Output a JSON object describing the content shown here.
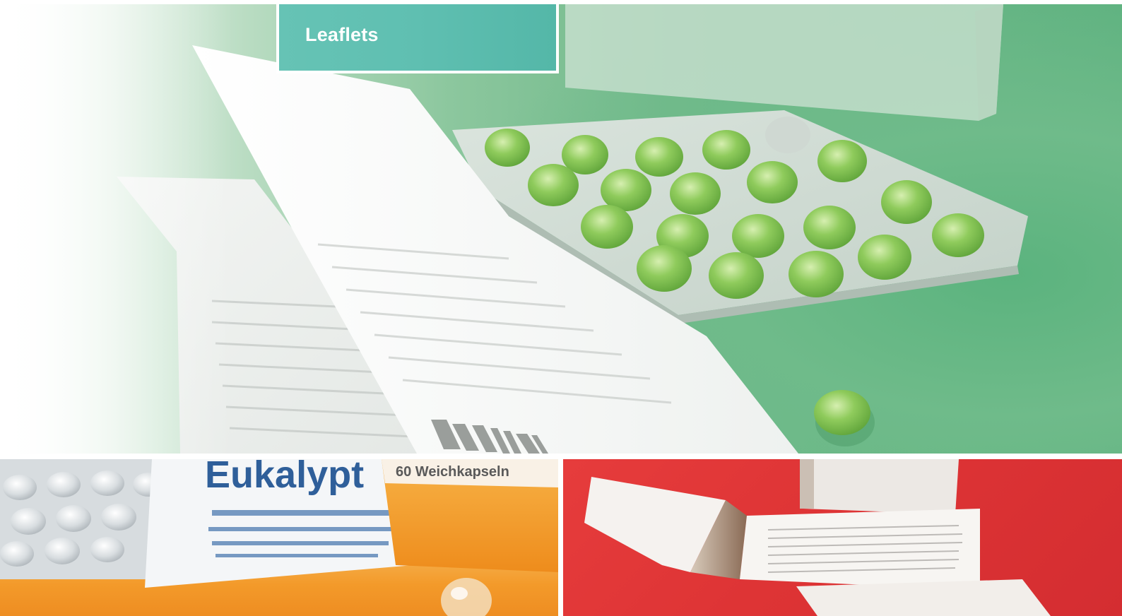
{
  "hero": {
    "title": "Leaflets",
    "title_color": "#ffffff",
    "card_color": "#5fbfb1",
    "background_color": "#6fbb8a",
    "icon": "blister-pack-icon"
  },
  "tiles": [
    {
      "id": "eukalyptus",
      "background_color": "#f39a2a",
      "product_text": "Eukalypt",
      "box_text": "60 Weichkapseln"
    },
    {
      "id": "folded-leaflet",
      "background_color": "#de3435"
    }
  ]
}
